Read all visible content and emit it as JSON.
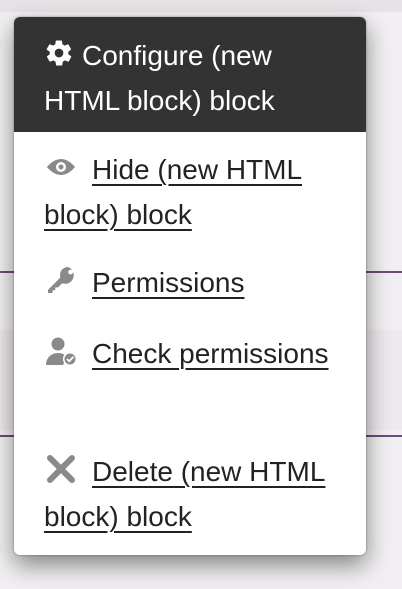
{
  "menu": {
    "header": {
      "icon": "gear-icon",
      "label": "Configure (new HTML block) block"
    },
    "items": [
      {
        "icon": "eye-icon",
        "label": "Hide (new HTML block) block"
      },
      {
        "icon": "key-icon",
        "label": "Permissions"
      },
      {
        "icon": "user-check-icon",
        "label": "Check permissions"
      },
      {
        "icon": "close-x-icon",
        "label": "Delete (new HTML block) block"
      }
    ]
  },
  "colors": {
    "header_bg": "#333333",
    "header_text": "#ffffff",
    "item_text": "#222222",
    "icon_gray": "#8a8a8a",
    "accent_line": "#6f4a7a"
  }
}
